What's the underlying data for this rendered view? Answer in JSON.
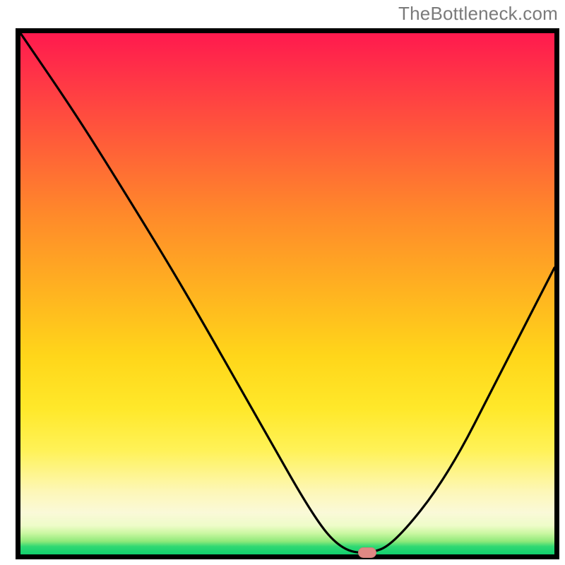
{
  "watermark": "TheBottleneck.com",
  "chart_data": {
    "type": "line",
    "title": "",
    "xlabel": "",
    "ylabel": "",
    "xlim": [
      0,
      100
    ],
    "ylim": [
      0,
      100
    ],
    "grid": false,
    "legend": false,
    "curve_points": [
      {
        "x": 0,
        "y": 100
      },
      {
        "x": 10,
        "y": 85
      },
      {
        "x": 18,
        "y": 72
      },
      {
        "x": 30,
        "y": 52
      },
      {
        "x": 45,
        "y": 25
      },
      {
        "x": 55,
        "y": 7
      },
      {
        "x": 60,
        "y": 1
      },
      {
        "x": 65,
        "y": 0
      },
      {
        "x": 70,
        "y": 2
      },
      {
        "x": 80,
        "y": 15
      },
      {
        "x": 90,
        "y": 35
      },
      {
        "x": 100,
        "y": 55
      }
    ],
    "minimum_marker": {
      "x": 65,
      "y": 0,
      "color": "#e08884"
    },
    "gradient_stops_top_to_bottom": [
      "#ff1a4e",
      "#ff5a3a",
      "#ffb420",
      "#ffe82a",
      "#fdf7b8",
      "#11d06e"
    ]
  }
}
